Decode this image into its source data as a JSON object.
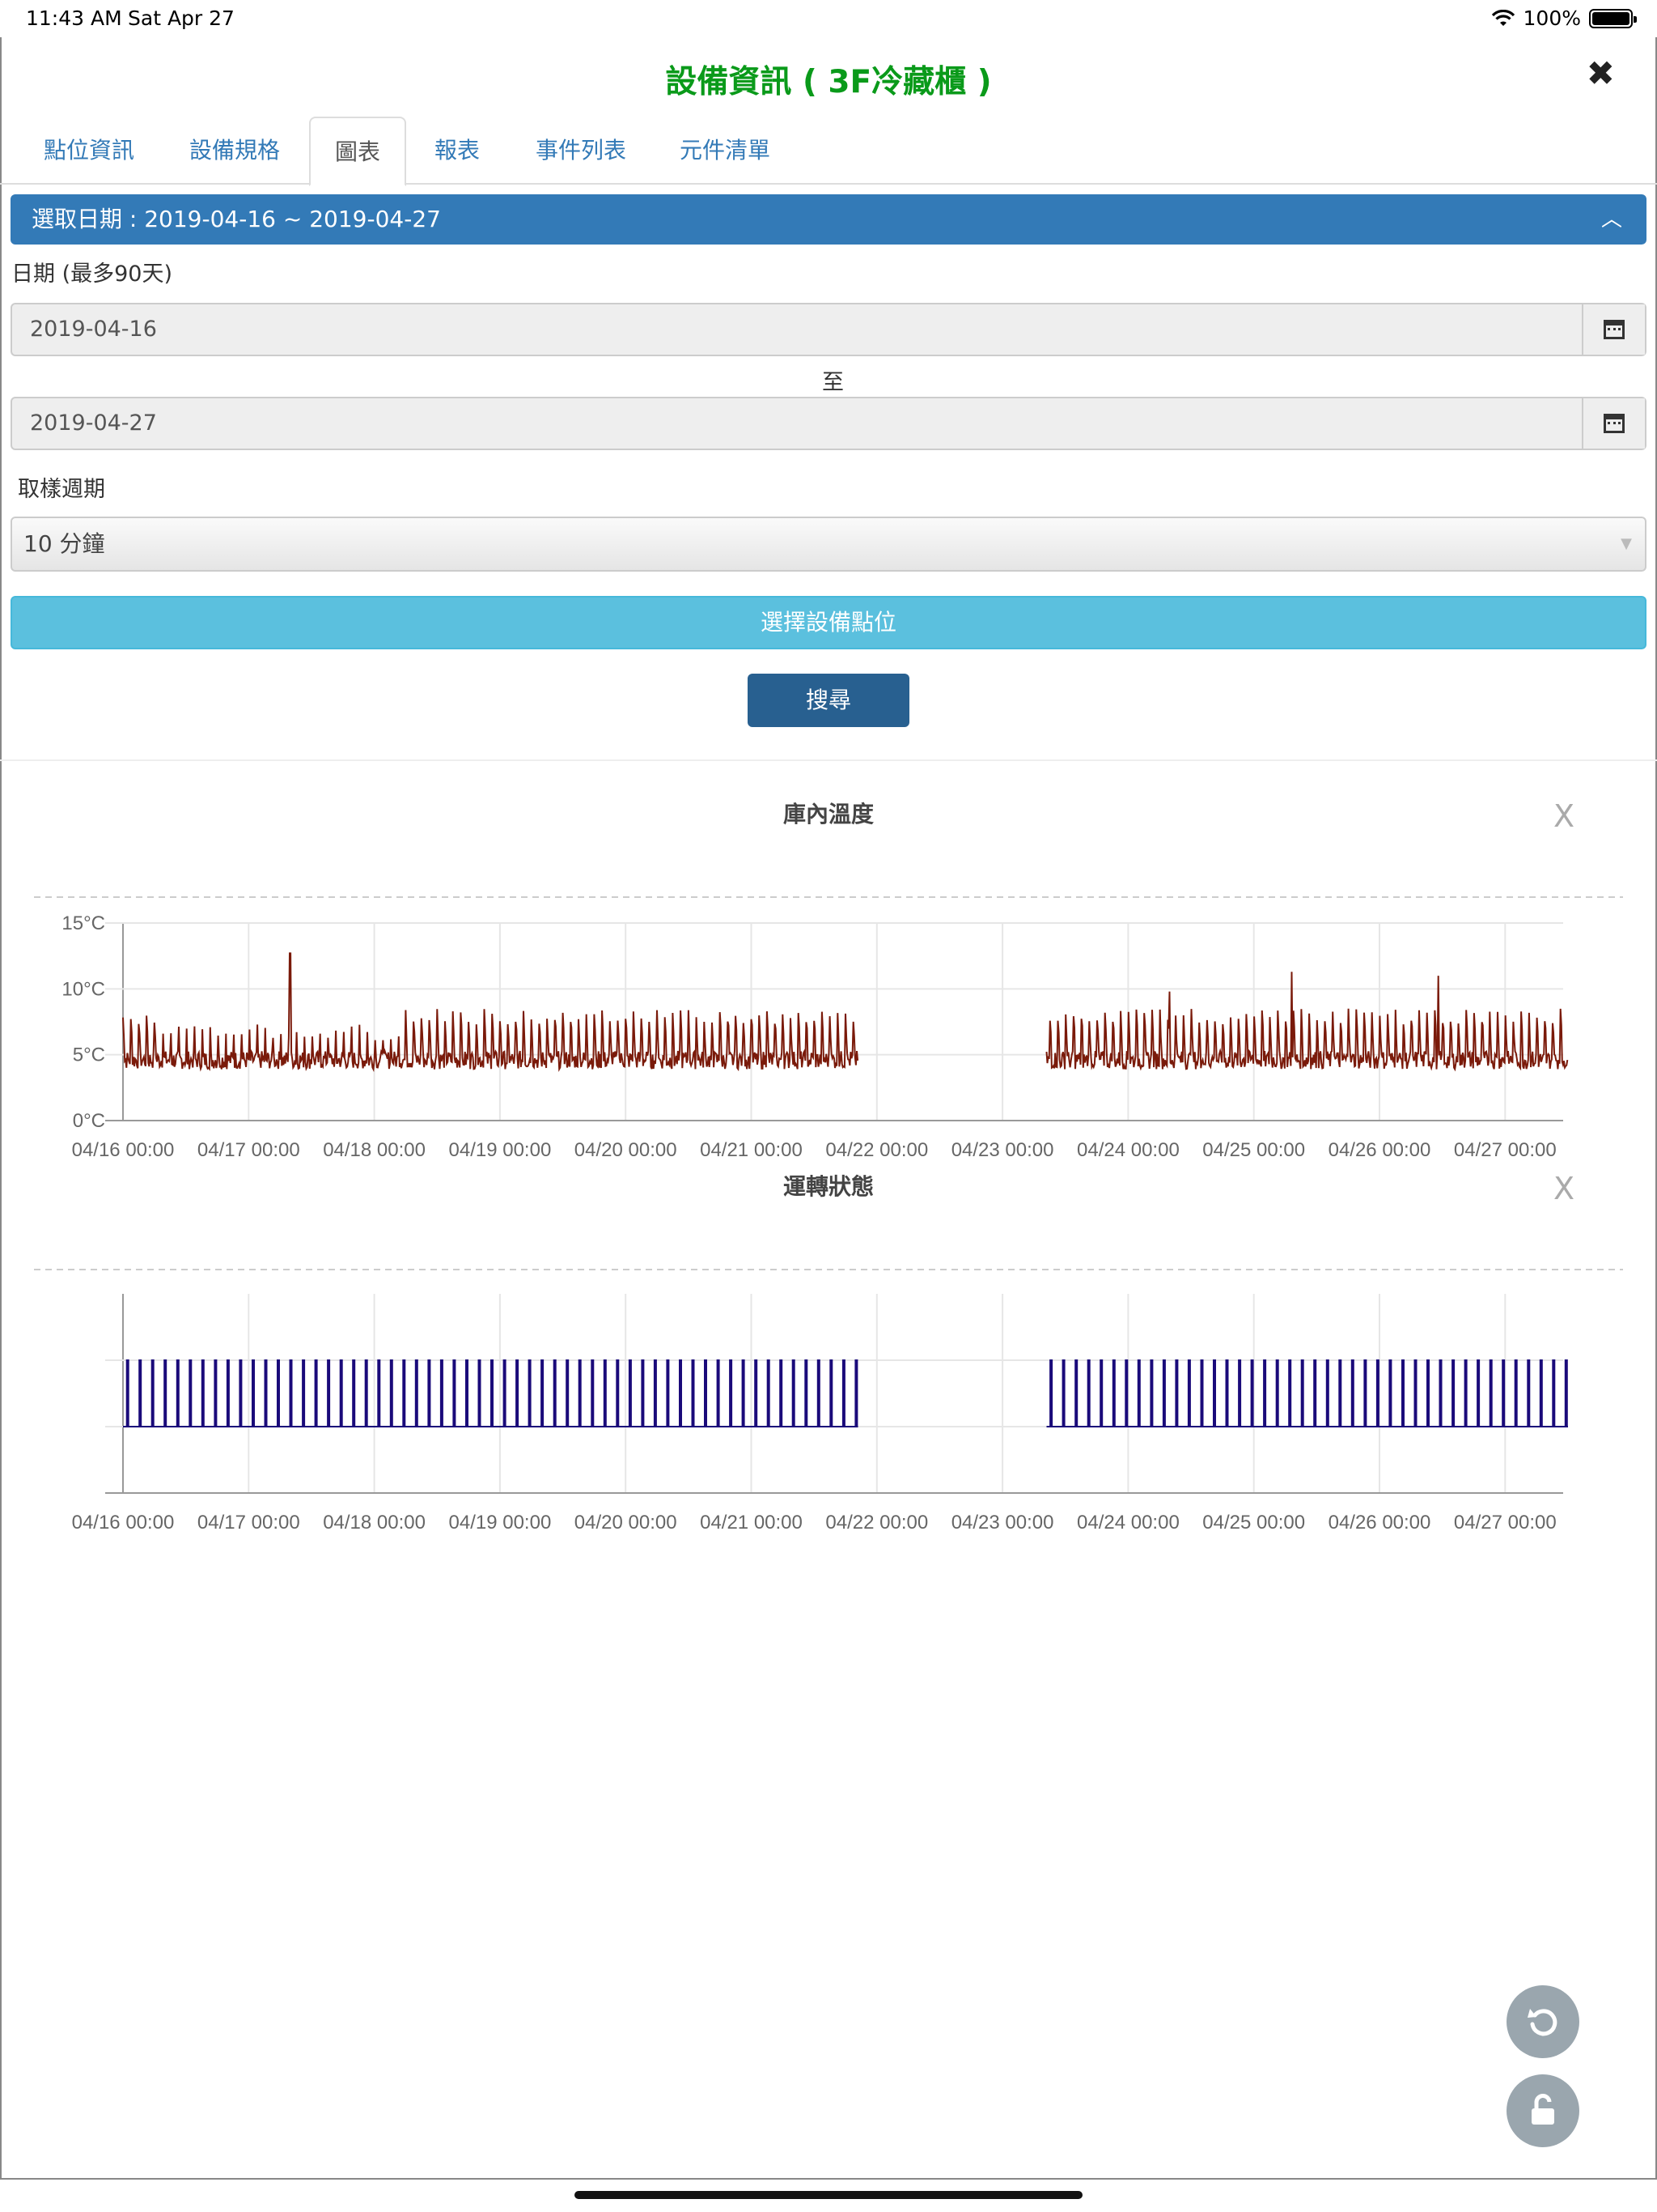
{
  "status": {
    "time": "11:43 AM",
    "date": "Sat Apr 27",
    "battery": "100%"
  },
  "header": {
    "title": "設備資訊 ( 3F冷藏櫃 )"
  },
  "tabs": [
    {
      "label": "點位資訊"
    },
    {
      "label": "設備規格"
    },
    {
      "label": "圖表",
      "active": true
    },
    {
      "label": "報表"
    },
    {
      "label": "事件列表"
    },
    {
      "label": "元件清單"
    }
  ],
  "filter": {
    "panel_title": "選取日期 : 2019-04-16 ~ 2019-04-27",
    "date_label": "日期 (最多90天)",
    "start_date": "2019-04-16",
    "to_label": "至",
    "end_date": "2019-04-27",
    "period_label": "取樣週期",
    "period_value": "10 分鐘",
    "select_points_label": "選擇設備點位",
    "search_label": "搜尋"
  },
  "chart_data": [
    {
      "type": "line",
      "title": "庫內溫度",
      "close_label": "X",
      "x_ticks": [
        "04/16 00:00",
        "04/17 00:00",
        "04/18 00:00",
        "04/19 00:00",
        "04/20 00:00",
        "04/21 00:00",
        "04/22 00:00",
        "04/23 00:00",
        "04/24 00:00",
        "04/25 00:00",
        "04/26 00:00",
        "04/27 00:00"
      ],
      "y_ticks": [
        "0°C",
        "5°C",
        "10°C",
        "15°C"
      ],
      "ylim": [
        0,
        15
      ],
      "x_range_days": [
        0,
        11.5
      ],
      "grid": true,
      "color": "#7a1a0a",
      "series": [
        {
          "segments": [
            {
              "start_day": 0.0,
              "end_day": 5.85,
              "baseline": 4.6,
              "peak": 8.5,
              "cycles_per_day": 16,
              "spikes": [
                {
                  "day": 1.33,
                  "value": 12.7
                }
              ]
            },
            {
              "start_day": 7.35,
              "end_day": 11.5,
              "baseline": 4.6,
              "peak": 8.5,
              "cycles_per_day": 16,
              "spikes": [
                {
                  "day": 8.33,
                  "value": 9.8
                },
                {
                  "day": 9.3,
                  "value": 11.3
                },
                {
                  "day": 10.47,
                  "value": 11.0
                }
              ]
            }
          ]
        }
      ]
    },
    {
      "type": "line",
      "title": "運轉狀態",
      "close_label": "X",
      "x_ticks": [
        "04/16 00:00",
        "04/17 00:00",
        "04/18 00:00",
        "04/19 00:00",
        "04/20 00:00",
        "04/21 00:00",
        "04/22 00:00",
        "04/23 00:00",
        "04/24 00:00",
        "04/25 00:00",
        "04/26 00:00",
        "04/27 00:00"
      ],
      "ylim": [
        0,
        2
      ],
      "x_range_days": [
        0,
        11.5
      ],
      "grid": true,
      "color": "#1a0a7a",
      "series": [
        {
          "segments": [
            {
              "start_day": 0.0,
              "end_day": 5.85,
              "low": 1,
              "high": 2,
              "pulses_per_day": 10
            },
            {
              "start_day": 7.35,
              "end_day": 11.5,
              "low": 1,
              "high": 2,
              "pulses_per_day": 10
            }
          ]
        }
      ]
    }
  ]
}
